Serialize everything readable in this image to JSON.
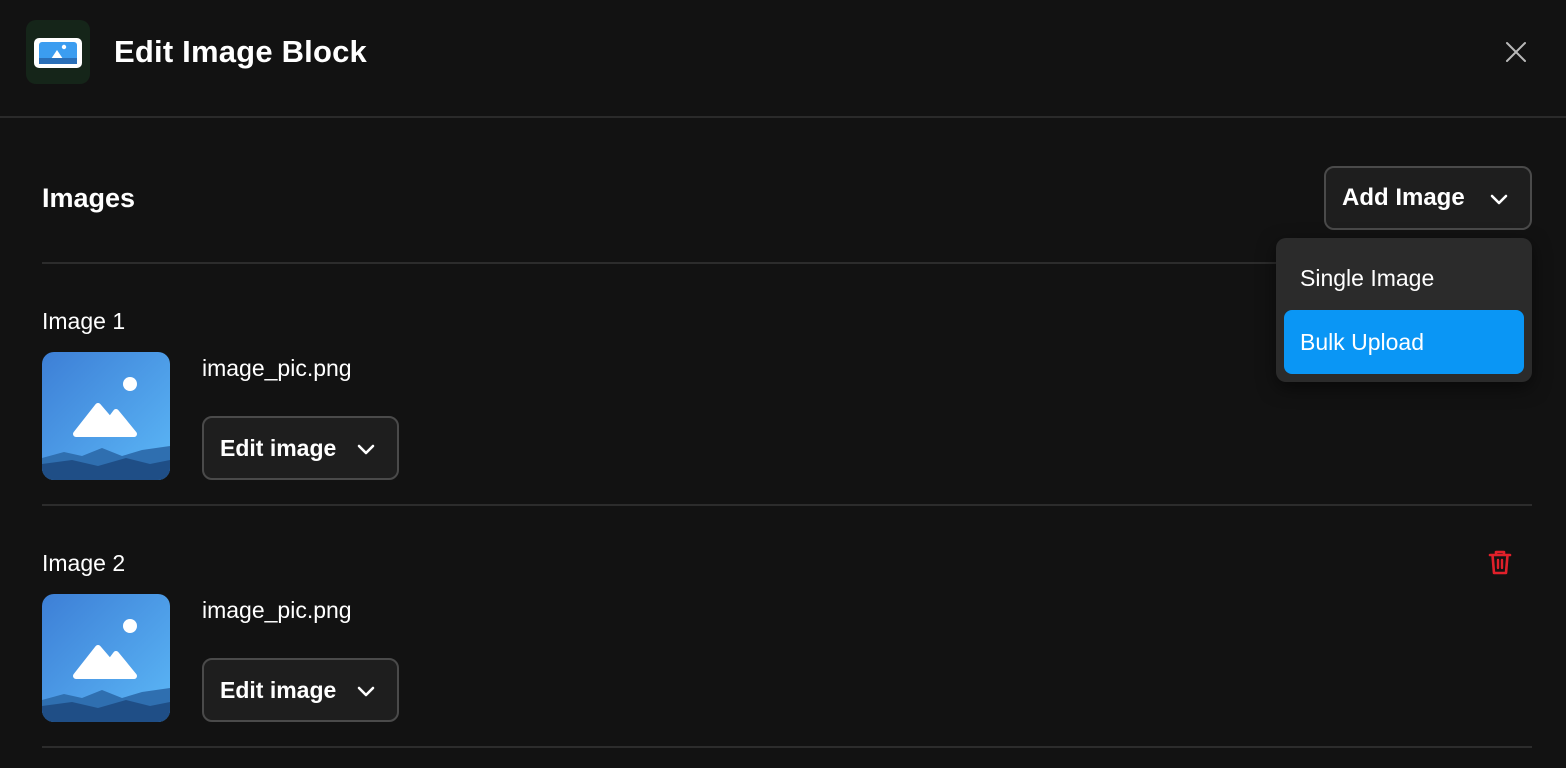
{
  "header": {
    "title": "Edit Image Block",
    "app_icon": "image-block-icon",
    "close_icon": "close-icon"
  },
  "section": {
    "title": "Images",
    "add_button_label": "Add Image"
  },
  "dropdown": {
    "items": [
      {
        "label": "Single Image",
        "active": false
      },
      {
        "label": "Bulk Upload",
        "active": true
      }
    ]
  },
  "images": [
    {
      "label": "Image 1",
      "filename": "image_pic.png",
      "edit_label": "Edit image"
    },
    {
      "label": "Image 2",
      "filename": "image_pic.png",
      "edit_label": "Edit image"
    }
  ],
  "colors": {
    "background": "#121212",
    "accent": "#0a96f5",
    "danger": "#e0202a",
    "app_icon_bg": "#152519"
  }
}
